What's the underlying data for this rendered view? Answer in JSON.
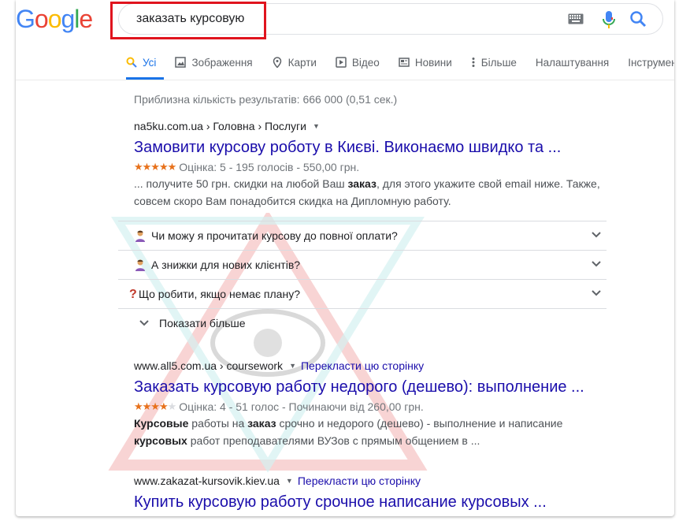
{
  "search": {
    "query": "заказать курсовую"
  },
  "logo": {
    "letters": [
      "G",
      "o",
      "o",
      "g",
      "l",
      "e"
    ],
    "colors": [
      "#4285F4",
      "#EA4335",
      "#FBBC05",
      "#4285F4",
      "#34A853",
      "#EA4335"
    ]
  },
  "tabs": [
    {
      "label": "Усі",
      "icon": "search-icon"
    },
    {
      "label": "Зображення",
      "icon": "image-icon"
    },
    {
      "label": "Карти",
      "icon": "map-pin-icon"
    },
    {
      "label": "Відео",
      "icon": "video-icon"
    },
    {
      "label": "Новини",
      "icon": "news-icon"
    },
    {
      "label": "Більше",
      "icon": "more-vert-icon"
    },
    {
      "label": "Налаштування"
    },
    {
      "label": "Інструмент"
    }
  ],
  "stats": "Приблизна кількість результатів: 666 000 (0,51 сек.)",
  "results": [
    {
      "cite": "na5ku.com.ua › Головна › Послуги",
      "title": "Замовити курсову роботу в Києві. Виконаємо швидко та ...",
      "rating_text": "Оцінка: 5 - 195 голосів - 550,00 грн.",
      "stars": 5,
      "snippet_pre": "... получите 50 грн. скидки на любой Ваш ",
      "snippet_bold": "заказ",
      "snippet_post": ", для этого укажите свой email ниже. Также, совсем скоро Вам понадобится скидка на Дипломную работу."
    },
    {
      "cite": "www.all5.com.ua › coursework",
      "translate": "Перекласти цю сторінку",
      "title": "Заказать курсовую работу недорого (дешево): выполнение ...",
      "rating_text": "Оцінка: 4 - 51 голос - Починаючи від 260,00 грн.",
      "stars": 4,
      "snippet_b1": "Курсовые",
      "snippet_t1": " работы на ",
      "snippet_b2": "заказ",
      "snippet_t2": " срочно и недорого (дешево) - выполнение и написание ",
      "snippet_b3": "курсовых",
      "snippet_t3": " работ преподавателями ВУЗов с прямым общением в ..."
    },
    {
      "cite": "www.zakazat-kursovik.kiev.ua",
      "translate": "Перекласти цю сторінку",
      "title": "Купить курсовую работу срочное написание курсовых ..."
    }
  ],
  "faq": [
    {
      "question": "Чи можу я прочитати курсову до повної оплати?",
      "emoji": "person-icon"
    },
    {
      "question": "А знижки для нових клієнтів?",
      "emoji": "person-icon"
    },
    {
      "question": "Що робити, якщо немає плану?",
      "emoji": "question-mark-icon"
    }
  ],
  "show_more": "Показати більше",
  "colors": {
    "link": "#1a0dab",
    "accent": "#1a73e8",
    "highlight": "#e0141e",
    "star": "#e7711b"
  }
}
